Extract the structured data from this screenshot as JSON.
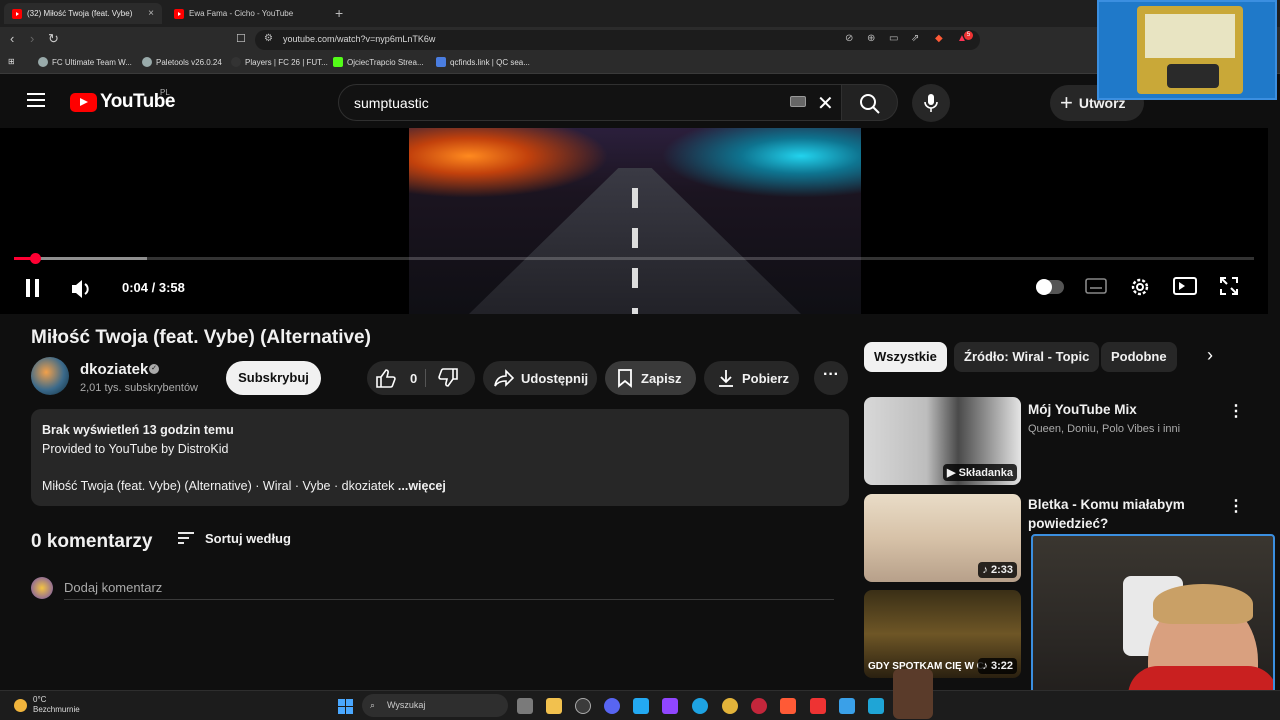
{
  "browser": {
    "tabs": [
      {
        "label": "(32) Miłość Twoja (feat. Vybe)"
      },
      {
        "label": "Ewa Fama - Cicho - YouTube"
      }
    ],
    "url": "youtube.com/watch?v=nyp6mLnTK6w",
    "bookmarks": [
      {
        "label": "FC Ultimate Team W..."
      },
      {
        "label": "Paletools v26.0.24"
      },
      {
        "label": "Players | FC 26 | FUT..."
      },
      {
        "label": "OjciecTrapcio Strea..."
      },
      {
        "label": "qcfinds.link | QC sea..."
      }
    ],
    "notification_count": "5"
  },
  "header": {
    "logo_text": "YouTube",
    "country_code": "PL",
    "search_query": "sumptuastic",
    "create_label": "Utwórz"
  },
  "player": {
    "time": "0:04 / 3:58",
    "progress_fraction": 0.017
  },
  "video": {
    "title": "Miłość Twoja (feat. Vybe) (Alternative)",
    "channel": "dkoziatek",
    "subscribers": "2,01 tys. subskrybentów",
    "subscribe_label": "Subskrybuj",
    "likes": "0",
    "share_label": "Udostępnij",
    "save_label": "Zapisz",
    "download_label": "Pobierz"
  },
  "description": {
    "meta": "Brak wyświetleń  13 godzin temu",
    "line1": "Provided to YouTube by DistroKid",
    "line2": "Miłość Twoja (feat. Vybe) (Alternative) · Wiral · Vybe · dkoziatek ",
    "more": "...więcej"
  },
  "comments": {
    "count": "0 komentarzy",
    "sort_label": "Sortuj według",
    "placeholder": "Dodaj komentarz"
  },
  "sidebar": {
    "chips": [
      "Wszystkie",
      "Źródło: Wiral - Topic",
      "Podobne"
    ],
    "items": [
      {
        "title": "Mój YouTube Mix",
        "subtitle": "Queen, Doniu, Polo Vibes i inni",
        "badge": "Składanka"
      },
      {
        "title": "Bletka - Komu miałabym powiedzieć?",
        "subtitle": "",
        "badge": "2:33"
      },
      {
        "title": "",
        "subtitle": "",
        "badge": "3:22",
        "thumb_text": "GDY SPOTKAM CIĘ W C"
      }
    ]
  },
  "taskbar": {
    "weather_temp": "0°C",
    "weather_desc": "Bezchmurnie",
    "search_label": "Wyszukaj"
  },
  "colors": {
    "accent": "#ff0033",
    "background": "#0f0f0f",
    "pill": "#272727"
  }
}
